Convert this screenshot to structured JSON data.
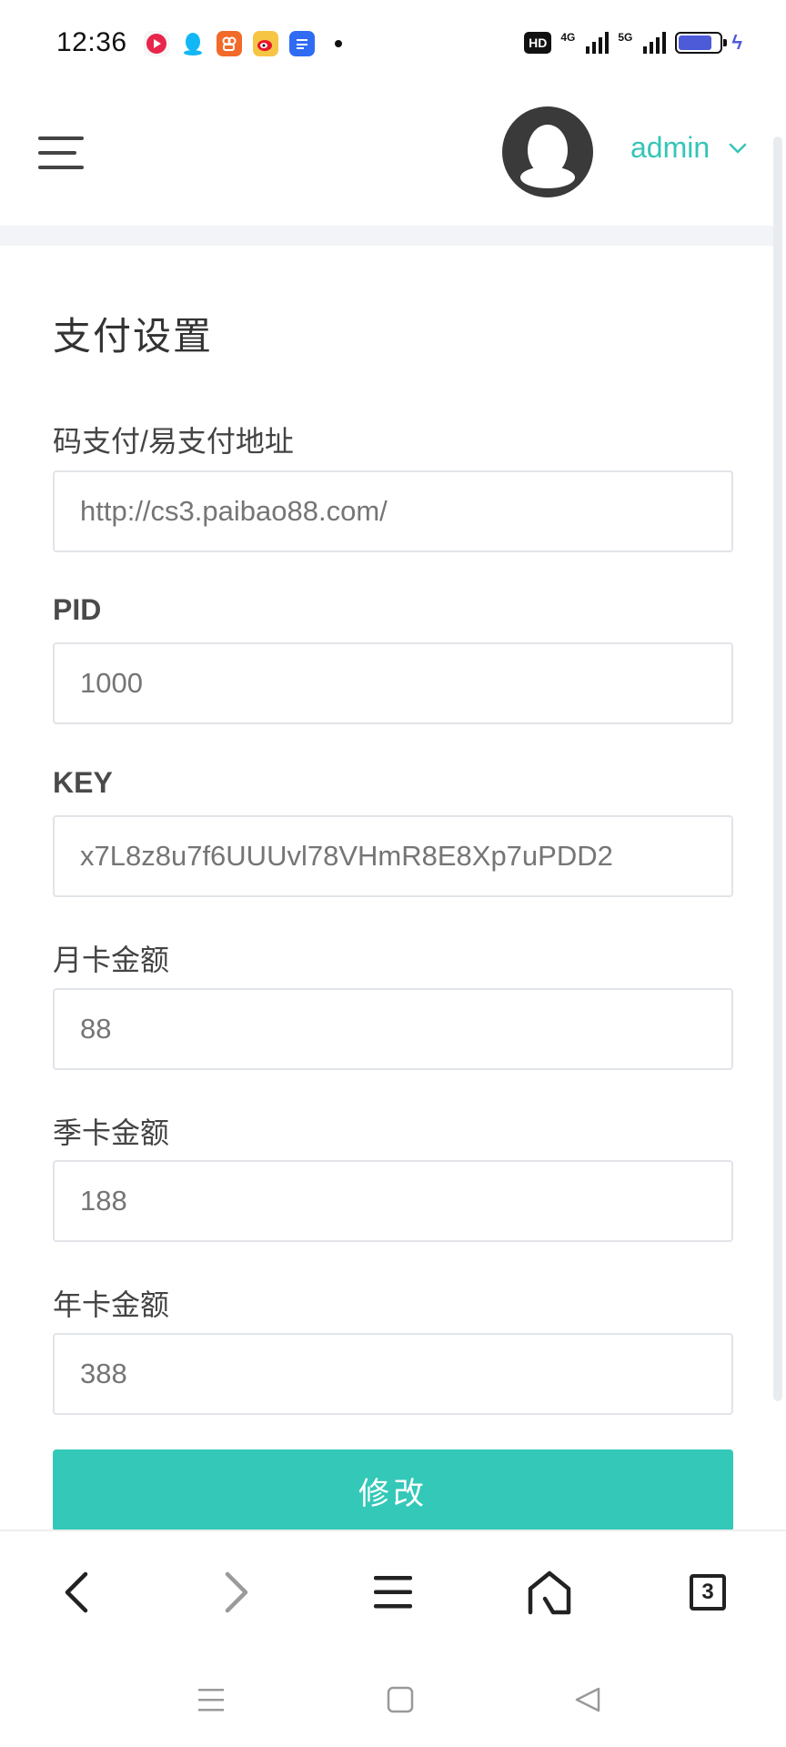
{
  "status_bar": {
    "time": "12:36",
    "hd_label": "HD",
    "net1": "4G",
    "net2": "5G"
  },
  "header": {
    "user_name": "admin",
    "accent_color": "#35c5b6"
  },
  "page": {
    "title": "支付设置"
  },
  "form": {
    "fields": [
      {
        "label": "码支付/易支付地址",
        "placeholder": "http://cs3.paibao88.com/"
      },
      {
        "label": "PID",
        "placeholder": "1000"
      },
      {
        "label": "KEY",
        "placeholder": "x7L8z8u7f6UUUvl78VHmR8E8Xp7uPDD2"
      },
      {
        "label": "月卡金额",
        "placeholder": "88"
      },
      {
        "label": "季卡金额",
        "placeholder": "188"
      },
      {
        "label": "年卡金额",
        "placeholder": "388"
      }
    ],
    "submit_label": "修改",
    "button_color": "#34c8b8"
  },
  "browser_toolbar": {
    "tab_count": "3"
  }
}
